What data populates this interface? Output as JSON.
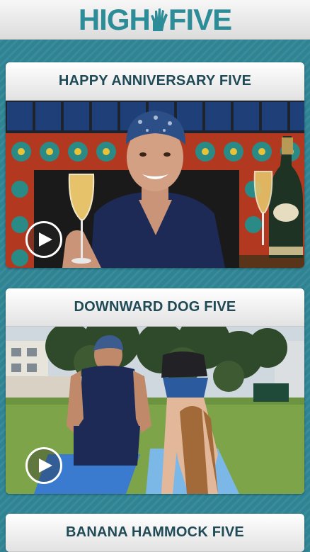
{
  "app": {
    "logo_text_left": "HIGH",
    "logo_text_right": "FIVE",
    "logo_icon": "hand-icon",
    "brand_color": "#2c8c98",
    "background_color": "#2f8494"
  },
  "videos": [
    {
      "title": "HAPPY ANNIVERSARY FIVE",
      "play_icon": "play-icon"
    },
    {
      "title": "DOWNWARD DOG FIVE",
      "play_icon": "play-icon"
    },
    {
      "title": "BANANA HAMMOCK FIVE",
      "play_icon": "play-icon"
    }
  ]
}
